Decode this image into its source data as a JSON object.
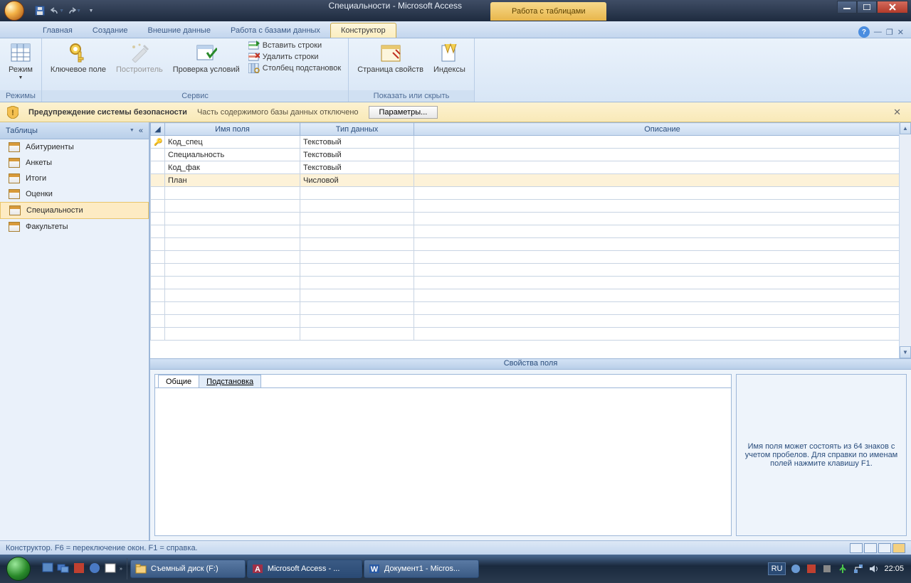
{
  "title": {
    "app": "Специальности - Microsoft Access",
    "contextual": "Работа с таблицами"
  },
  "ribbon_tabs": {
    "t0": "Главная",
    "t1": "Создание",
    "t2": "Внешние данные",
    "t3": "Работа с базами данных",
    "t4": "Конструктор"
  },
  "ribbon": {
    "g1": {
      "btn": "Режим",
      "label": "Режимы"
    },
    "g2": {
      "key": "Ключевое поле",
      "builder": "Построитель",
      "check": "Проверка условий",
      "insert": "Вставить строки",
      "delete": "Удалить строки",
      "lookup": "Столбец подстановок",
      "label": "Сервис"
    },
    "g3": {
      "prop": "Страница свойств",
      "idx": "Индексы",
      "label": "Показать или скрыть"
    }
  },
  "security": {
    "title": "Предупреждение системы безопасности",
    "msg": "Часть содержимого базы данных отключено",
    "btn": "Параметры..."
  },
  "nav": {
    "header": "Таблицы",
    "items": {
      "i0": "Абитуриенты",
      "i1": "Анкеты",
      "i2": "Итоги",
      "i3": "Оценки",
      "i4": "Специальности",
      "i5": "Факультеты"
    }
  },
  "grid": {
    "h_name": "Имя поля",
    "h_type": "Тип данных",
    "h_desc": "Описание",
    "rows": {
      "r0": {
        "name": "Код_спец",
        "type": "Текстовый"
      },
      "r1": {
        "name": "Специальность",
        "type": "Текстовый"
      },
      "r2": {
        "name": "Код_фак",
        "type": "Текстовый"
      },
      "r3": {
        "name": "План",
        "type": "Числовой"
      }
    }
  },
  "props": {
    "split": "Свойства поля",
    "tab_general": "Общие",
    "tab_lookup": "Подстановка",
    "help": "Имя поля может состоять из 64 знаков с учетом пробелов.  Для справки по именам полей нажмите клавишу F1."
  },
  "status": "Конструктор.  F6 = переключение окон.  F1 = справка.",
  "taskbar": {
    "t0": "Съемный диск (F:)",
    "t1": "Microsoft Access - ...",
    "t2": "Документ1 - Micros...",
    "lang": "RU",
    "time": "22:05"
  }
}
